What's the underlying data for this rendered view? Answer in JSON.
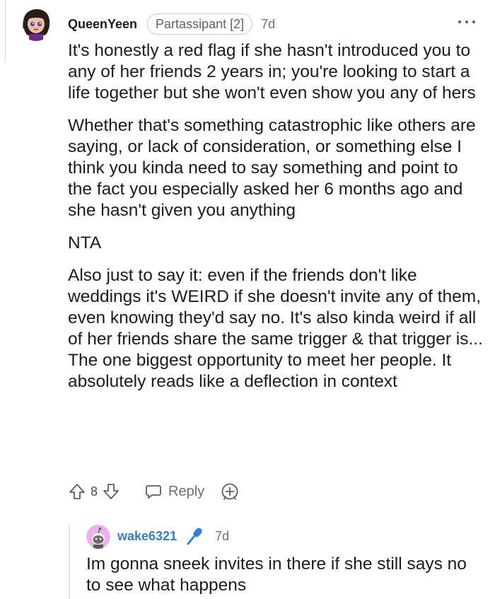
{
  "comment": {
    "username": "QueenYeen",
    "flair": "Partassipant [2]",
    "time": "7d",
    "avatar_icon": "user-avatar-icon",
    "paragraphs": [
      "It's honestly a red flag if she hasn't introduced you to any of her friends 2 years in; you're looking to start a life together but she won't even show you any of hers",
      "Whether that's something catastrophic like others are saying, or lack of consideration, or something else I think you kinda need to say something and point to the fact you especially asked her 6 months ago and she hasn't given you anything",
      "NTA",
      "Also just to say it: even if the friends don't like weddings it's WEIRD if she doesn't invite any of them, even knowing they'd say no. It's also kinda weird if all of her friends share the same trigger & that trigger is... The one biggest opportunity to meet her people. It absolutely reads like a deflection in context"
    ],
    "score": "8",
    "reply_label": "Reply"
  },
  "reply": {
    "username": "wake6321",
    "time": "7d",
    "text": "Im gonna sneek invites in there if she still says no to see what happens"
  },
  "colors": {
    "text": "#1c1c1c",
    "meta": "#6f7275",
    "reply_username": "#3a7bbf",
    "mic_badge": "#2f80d6",
    "reply_avatar_bg": "#e7b3e8"
  }
}
